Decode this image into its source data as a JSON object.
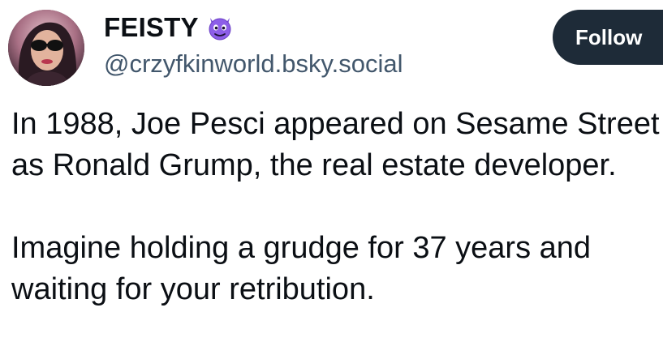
{
  "author": {
    "display_name": "FEISTY",
    "name_emoji": "smiling-imp-emoji-icon",
    "handle": "@crzyfkinworld.bsky.social"
  },
  "actions": {
    "follow_label": "Follow"
  },
  "post": {
    "paragraphs": [
      "In 1988, Joe Pesci appeared on Sesame Street as Ronald Grump, the real estate developer.",
      "Imagine holding a grudge for 37 years and waiting for your retribution."
    ]
  },
  "colors": {
    "text": "#0b0f14",
    "handle": "#42576c",
    "follow_bg": "#1e2b38",
    "follow_text": "#ffffff",
    "emoji": "#7b4fd6"
  }
}
